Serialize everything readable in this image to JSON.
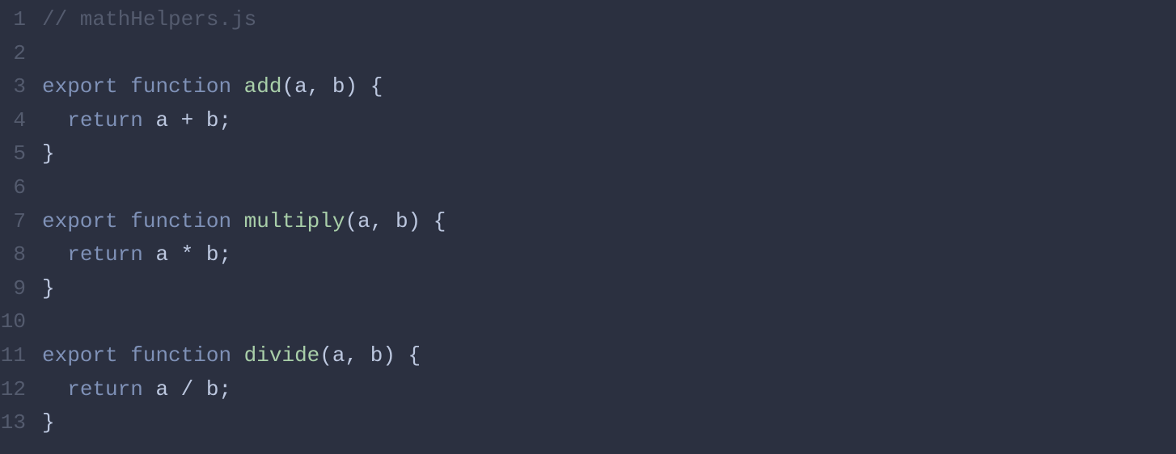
{
  "code": {
    "language": "javascript",
    "lines": [
      {
        "num": "1",
        "tokens": [
          {
            "cls": "comment",
            "text": "// mathHelpers.js"
          }
        ]
      },
      {
        "num": "2",
        "tokens": []
      },
      {
        "num": "3",
        "tokens": [
          {
            "cls": "keyword",
            "text": "export"
          },
          {
            "cls": "plain",
            "text": " "
          },
          {
            "cls": "keyword",
            "text": "function"
          },
          {
            "cls": "plain",
            "text": " "
          },
          {
            "cls": "function-name",
            "text": "add"
          },
          {
            "cls": "punctuation",
            "text": "("
          },
          {
            "cls": "param",
            "text": "a"
          },
          {
            "cls": "punctuation",
            "text": ", "
          },
          {
            "cls": "param",
            "text": "b"
          },
          {
            "cls": "punctuation",
            "text": ") {"
          }
        ]
      },
      {
        "num": "4",
        "tokens": [
          {
            "cls": "plain",
            "text": "  "
          },
          {
            "cls": "keyword",
            "text": "return"
          },
          {
            "cls": "plain",
            "text": " a "
          },
          {
            "cls": "operator",
            "text": "+"
          },
          {
            "cls": "plain",
            "text": " b"
          },
          {
            "cls": "punctuation",
            "text": ";"
          }
        ]
      },
      {
        "num": "5",
        "tokens": [
          {
            "cls": "punctuation",
            "text": "}"
          }
        ]
      },
      {
        "num": "6",
        "tokens": []
      },
      {
        "num": "7",
        "tokens": [
          {
            "cls": "keyword",
            "text": "export"
          },
          {
            "cls": "plain",
            "text": " "
          },
          {
            "cls": "keyword",
            "text": "function"
          },
          {
            "cls": "plain",
            "text": " "
          },
          {
            "cls": "function-name",
            "text": "multiply"
          },
          {
            "cls": "punctuation",
            "text": "("
          },
          {
            "cls": "param",
            "text": "a"
          },
          {
            "cls": "punctuation",
            "text": ", "
          },
          {
            "cls": "param",
            "text": "b"
          },
          {
            "cls": "punctuation",
            "text": ") {"
          }
        ]
      },
      {
        "num": "8",
        "tokens": [
          {
            "cls": "plain",
            "text": "  "
          },
          {
            "cls": "keyword",
            "text": "return"
          },
          {
            "cls": "plain",
            "text": " a "
          },
          {
            "cls": "operator",
            "text": "*"
          },
          {
            "cls": "plain",
            "text": " b"
          },
          {
            "cls": "punctuation",
            "text": ";"
          }
        ]
      },
      {
        "num": "9",
        "tokens": [
          {
            "cls": "punctuation",
            "text": "}"
          }
        ]
      },
      {
        "num": "10",
        "tokens": []
      },
      {
        "num": "11",
        "tokens": [
          {
            "cls": "keyword",
            "text": "export"
          },
          {
            "cls": "plain",
            "text": " "
          },
          {
            "cls": "keyword",
            "text": "function"
          },
          {
            "cls": "plain",
            "text": " "
          },
          {
            "cls": "function-name",
            "text": "divide"
          },
          {
            "cls": "punctuation",
            "text": "("
          },
          {
            "cls": "param",
            "text": "a"
          },
          {
            "cls": "punctuation",
            "text": ", "
          },
          {
            "cls": "param",
            "text": "b"
          },
          {
            "cls": "punctuation",
            "text": ") {"
          }
        ]
      },
      {
        "num": "12",
        "tokens": [
          {
            "cls": "plain",
            "text": "  "
          },
          {
            "cls": "keyword",
            "text": "return"
          },
          {
            "cls": "plain",
            "text": " a "
          },
          {
            "cls": "operator",
            "text": "/"
          },
          {
            "cls": "plain",
            "text": " b"
          },
          {
            "cls": "punctuation",
            "text": ";"
          }
        ]
      },
      {
        "num": "13",
        "tokens": [
          {
            "cls": "punctuation",
            "text": "}"
          }
        ]
      }
    ]
  }
}
